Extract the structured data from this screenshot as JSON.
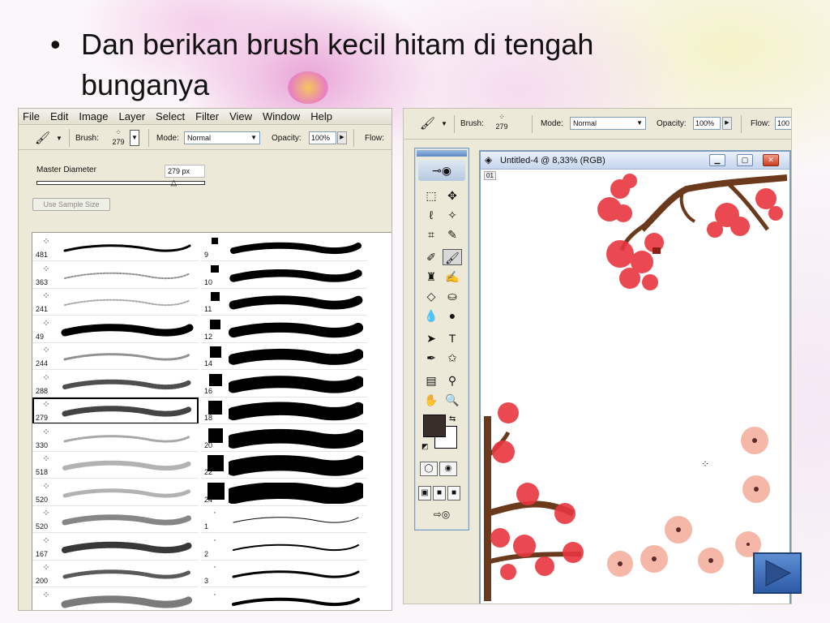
{
  "slide": {
    "bullet_glyph": "•",
    "bullet_text": "Dan berikan brush kecil hitam di tengah bunganya"
  },
  "left_app": {
    "menu": [
      "File",
      "Edit",
      "Image",
      "Layer",
      "Select",
      "Filter",
      "View",
      "Window",
      "Help"
    ],
    "options": {
      "brush_label": "Brush:",
      "brush_size": "279",
      "mode_label": "Mode:",
      "mode_value": "Normal",
      "opacity_label": "Opacity:",
      "opacity_value": "100%",
      "flow_label": "Flow:"
    },
    "brush_picker": {
      "master_diameter_label": "Master Diameter",
      "master_diameter_value": "279 px",
      "master_diameter_fraction": 0.82,
      "sample_size_button": "Use Sample Size",
      "left_column": [
        "481",
        "363",
        "241",
        "49",
        "244",
        "288",
        "279",
        "330",
        "518",
        "520",
        "520",
        "167",
        "200",
        ""
      ],
      "right_column": [
        "9",
        "10",
        "11",
        "12",
        "14",
        "16",
        "18",
        "20",
        "22",
        "24",
        "1",
        "2",
        "3",
        ""
      ],
      "selected": "279"
    }
  },
  "right_app": {
    "options": {
      "brush_label": "Brush:",
      "brush_size": "279",
      "mode_label": "Mode:",
      "mode_value": "Normal",
      "opacity_label": "Opacity:",
      "opacity_value": "100%",
      "flow_label": "Flow:",
      "flow_value": "100"
    },
    "document": {
      "title": "Untitled-4 @ 8,33% (RGB)",
      "info_tag": "01"
    },
    "colors": {
      "foreground": "#3a2e2b",
      "background": "#ffffff",
      "blossom": "#e8363f",
      "peach": "#f4b4a4",
      "branch": "#6b3a1c"
    }
  },
  "navigation": {
    "next_icon": "play-triangle-icon"
  }
}
